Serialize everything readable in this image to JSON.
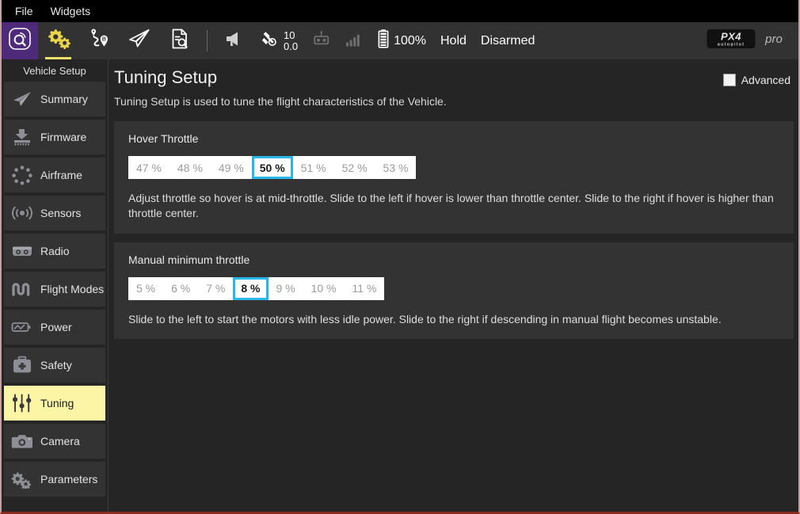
{
  "menubar": {
    "items": [
      {
        "label": "File",
        "name": "menu-file"
      },
      {
        "label": "Widgets",
        "name": "menu-widgets"
      }
    ]
  },
  "toolbar": {
    "app_logo": "qgc-logo-icon",
    "nav_icons": [
      {
        "name": "gears-icon",
        "label": "Vehicle Setup",
        "active": true
      },
      {
        "name": "plan-route-icon",
        "label": "Plan",
        "active": false
      },
      {
        "name": "paper-plane-icon",
        "label": "Fly",
        "active": false
      },
      {
        "name": "analyze-document-icon",
        "label": "Analyze",
        "active": false
      }
    ],
    "status": {
      "message_icon": "megaphone-icon",
      "gps_icon": "satellite-icon",
      "gps_count": "10",
      "gps_hdop": "0.0",
      "rc_icon": "rc-transmitter-icon",
      "telemetry_icon": "signal-bars-icon",
      "battery_icon": "battery-icon",
      "battery_percent": "100%",
      "flight_mode": "Hold",
      "arm_state": "Disarmed"
    },
    "brand": {
      "mark": "PX4",
      "mark_sub": "autopilot",
      "suffix": "pro"
    }
  },
  "sidebar": {
    "title": "Vehicle Setup",
    "items": [
      {
        "label": "Summary",
        "icon": "paper-plane-icon",
        "selected": false
      },
      {
        "label": "Firmware",
        "icon": "firmware-icon",
        "selected": false
      },
      {
        "label": "Airframe",
        "icon": "airframe-icon",
        "selected": false
      },
      {
        "label": "Sensors",
        "icon": "sensors-icon",
        "selected": false
      },
      {
        "label": "Radio",
        "icon": "radio-icon",
        "selected": false
      },
      {
        "label": "Flight Modes",
        "icon": "flight-modes-icon",
        "selected": false
      },
      {
        "label": "Power",
        "icon": "power-icon",
        "selected": false
      },
      {
        "label": "Safety",
        "icon": "safety-icon",
        "selected": false
      },
      {
        "label": "Tuning",
        "icon": "tuning-icon",
        "selected": true
      },
      {
        "label": "Camera",
        "icon": "camera-icon",
        "selected": false
      },
      {
        "label": "Parameters",
        "icon": "parameters-icon",
        "selected": false
      }
    ]
  },
  "main": {
    "title": "Tuning Setup",
    "subtitle": "Tuning Setup is used to tune the flight characteristics of the Vehicle.",
    "advanced": {
      "label": "Advanced",
      "checked": false
    },
    "sections": [
      {
        "title": "Hover Throttle",
        "value": "50 %",
        "ticks": [
          "47 %",
          "48 %",
          "49 %",
          "50 %",
          "51 %",
          "52 %",
          "53 %"
        ],
        "selected_index": 3,
        "description": "Adjust throttle so hover is at mid-throttle. Slide to the left if hover is lower than throttle center. Slide to the right if hover is higher than throttle center."
      },
      {
        "title": "Manual minimum throttle",
        "value": "8 %",
        "ticks": [
          "5 %",
          "6 %",
          "7 %",
          "8 %",
          "9 %",
          "10 %",
          "11 %"
        ],
        "selected_index": 3,
        "description": "Slide to the left to start the motors with less idle power. Slide to the right if descending in manual flight becomes unstable."
      }
    ]
  },
  "colors": {
    "accent_selection": "#29b6e8",
    "accent_active_tab": "#f2e06a",
    "sidebar_selected": "#fdf5a6",
    "logo_purple": "#4d2a7a",
    "panel": "#333333",
    "background": "#252525"
  }
}
